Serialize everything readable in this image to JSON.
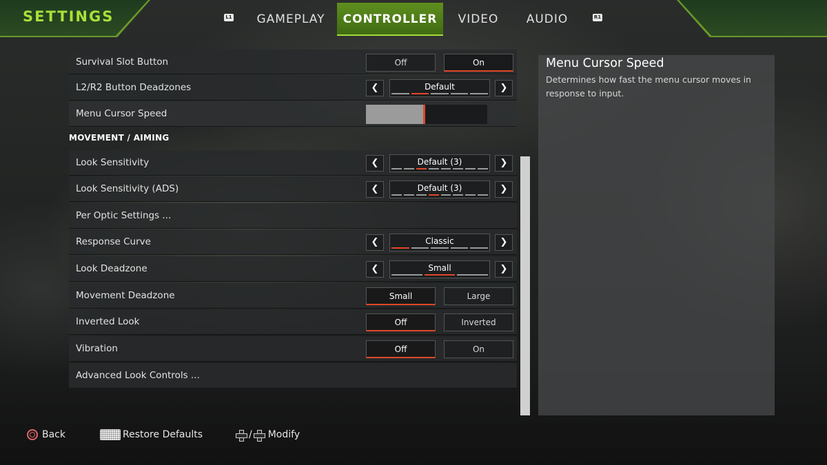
{
  "header": {
    "title": "SETTINGS",
    "bumper_left": "L1",
    "bumper_right": "R1",
    "tabs": [
      {
        "label": "GAMEPLAY",
        "active": false
      },
      {
        "label": "CONTROLLER",
        "active": true
      },
      {
        "label": "VIDEO",
        "active": false
      },
      {
        "label": "AUDIO",
        "active": false
      }
    ]
  },
  "section_movement": "MOVEMENT / AIMING",
  "rows": {
    "survival_slot": {
      "label": "Survival Slot Button",
      "options": [
        "Off",
        "On"
      ],
      "selected": "On"
    },
    "deadzones": {
      "label": "L2/R2 Button Deadzones",
      "value": "Default",
      "segments": 5,
      "active_segment": 1
    },
    "cursor_speed": {
      "label": "Menu Cursor Speed",
      "level_fraction": 0.47
    },
    "look_sens": {
      "label": "Look Sensitivity",
      "value": "Default (3)",
      "segments": 8,
      "active_segment": 2
    },
    "look_sens_ads": {
      "label": "Look Sensitivity (ADS)",
      "value": "Default (3)",
      "segments": 8,
      "active_segment": 3
    },
    "per_optic": {
      "label": "Per Optic Settings ..."
    },
    "response_curve": {
      "label": "Response Curve",
      "value": "Classic",
      "segments": 5,
      "active_segment": 0
    },
    "look_deadzone": {
      "label": "Look Deadzone",
      "value": "Small",
      "segments": 3,
      "active_segment": 1
    },
    "movement_deadzone": {
      "label": "Movement Deadzone",
      "options": [
        "Small",
        "Large"
      ],
      "selected": "Small"
    },
    "inverted_look": {
      "label": "Inverted Look",
      "options": [
        "Off",
        "Inverted"
      ],
      "selected": "Off"
    },
    "vibration": {
      "label": "Vibration",
      "options": [
        "Off",
        "On"
      ],
      "selected": "Off"
    },
    "advanced_look": {
      "label": "Advanced Look Controls ..."
    }
  },
  "description": {
    "title": "Menu Cursor Speed",
    "text": "Determines how fast the menu cursor moves in response to input."
  },
  "footer": {
    "back": "Back",
    "restore": "Restore Defaults",
    "modify": "Modify",
    "separator": "/"
  },
  "colors": {
    "accent_green": "#a8e03a",
    "accent_red": "#e0472a",
    "tab_active": "#5f8e1f"
  }
}
